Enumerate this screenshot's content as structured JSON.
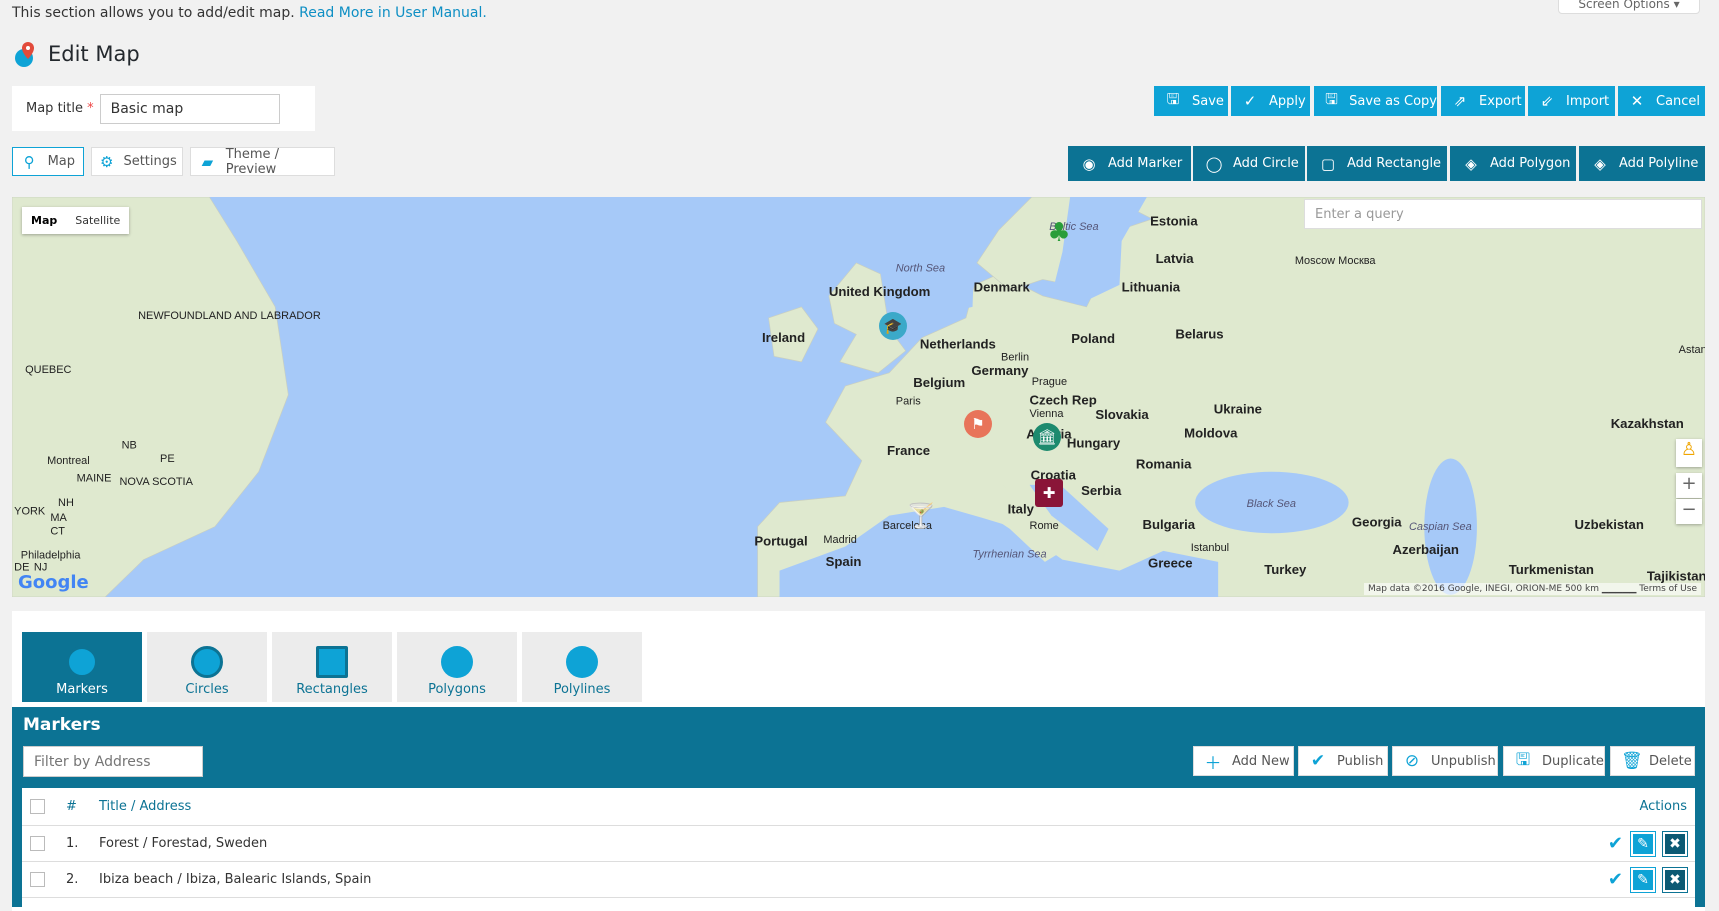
{
  "intro": {
    "text": "This section allows you to add/edit map.",
    "link": "Read More in User Manual."
  },
  "screen_options": "Screen Options",
  "page_title": "Edit Map",
  "map_title": {
    "label": "Map title",
    "required": "*",
    "value": "Basic map"
  },
  "actions": {
    "save": "Save",
    "apply": "Apply",
    "save_copy": "Save as Copy",
    "export": "Export",
    "import": "Import",
    "cancel": "Cancel"
  },
  "tabs": {
    "map": "Map",
    "settings": "Settings",
    "theme": "Theme / Preview"
  },
  "add_buttons": {
    "marker": "Add Marker",
    "circle": "Add Circle",
    "rectangle": "Add Rectangle",
    "polygon": "Add Polygon",
    "polyline": "Add Polyline"
  },
  "map": {
    "type_map": "Map",
    "type_satellite": "Satellite",
    "query_placeholder": "Enter a query",
    "attribution": "Map data ©2016 Google, INEGI, ORION-ME   500 km ▁▁▁▁▁   Terms of Use",
    "logo": "Google",
    "labels": [
      "Estonia",
      "Latvia",
      "Lithuania",
      "Baltic Sea",
      "North Sea",
      "Denmark",
      "United Kingdom",
      "Ireland",
      "Netherlands",
      "Berlin",
      "Poland",
      "Belarus",
      "Moscow Москва",
      "Germany",
      "Belgium",
      "Prague",
      "Czech Rep",
      "Vienna",
      "Slovakia",
      "Paris",
      "Austria",
      "Hungary",
      "Ukraine",
      "Moldova",
      "Kazakhstan",
      "Astana Астана",
      "France",
      "Croatia",
      "Romania",
      "Serbia",
      "Black Sea",
      "Caspian Sea",
      "Bulgaria",
      "Georgia",
      "Uzbekistan",
      "Italy",
      "Rome",
      "Barcelona",
      "Madrid",
      "Portugal",
      "Spain",
      "Tyrrhenian Sea",
      "Istanbul",
      "Azerbaijan",
      "Greece",
      "Turkey",
      "Turkmenistan",
      "Tajikistan",
      "NEWFOUNDLAND AND LABRADOR",
      "QUEBEC",
      "Montreal",
      "NB",
      "PE",
      "MAINE",
      "NOVA SCOTIA",
      "NH",
      "MA",
      "CT",
      "YORK",
      "Philadelphia",
      "DE",
      "NJ"
    ],
    "zoom_in": "+",
    "zoom_out": "−"
  },
  "lower_tabs": [
    "Markers",
    "Circles",
    "Rectangles",
    "Polygons",
    "Polylines"
  ],
  "markers": {
    "heading": "Markers",
    "filter_placeholder": "Filter by Address",
    "buttons": {
      "add_new": "Add New",
      "publish": "Publish",
      "unpublish": "Unpublish",
      "duplicate": "Duplicate",
      "delete": "Delete"
    },
    "columns": {
      "num": "#",
      "title": "Title / Address",
      "actions": "Actions"
    },
    "rows": [
      {
        "num": "1.",
        "title": "Forest / Forestad, Sweden",
        "published": true
      },
      {
        "num": "2.",
        "title": "Ibiza beach / Ibiza, Balearic Islands, Spain",
        "published": true
      }
    ]
  },
  "colors": {
    "primary": "#0ea3d6",
    "dark": "#0c7394",
    "water": "#a6c9f8",
    "land": "#dfe9cf"
  }
}
